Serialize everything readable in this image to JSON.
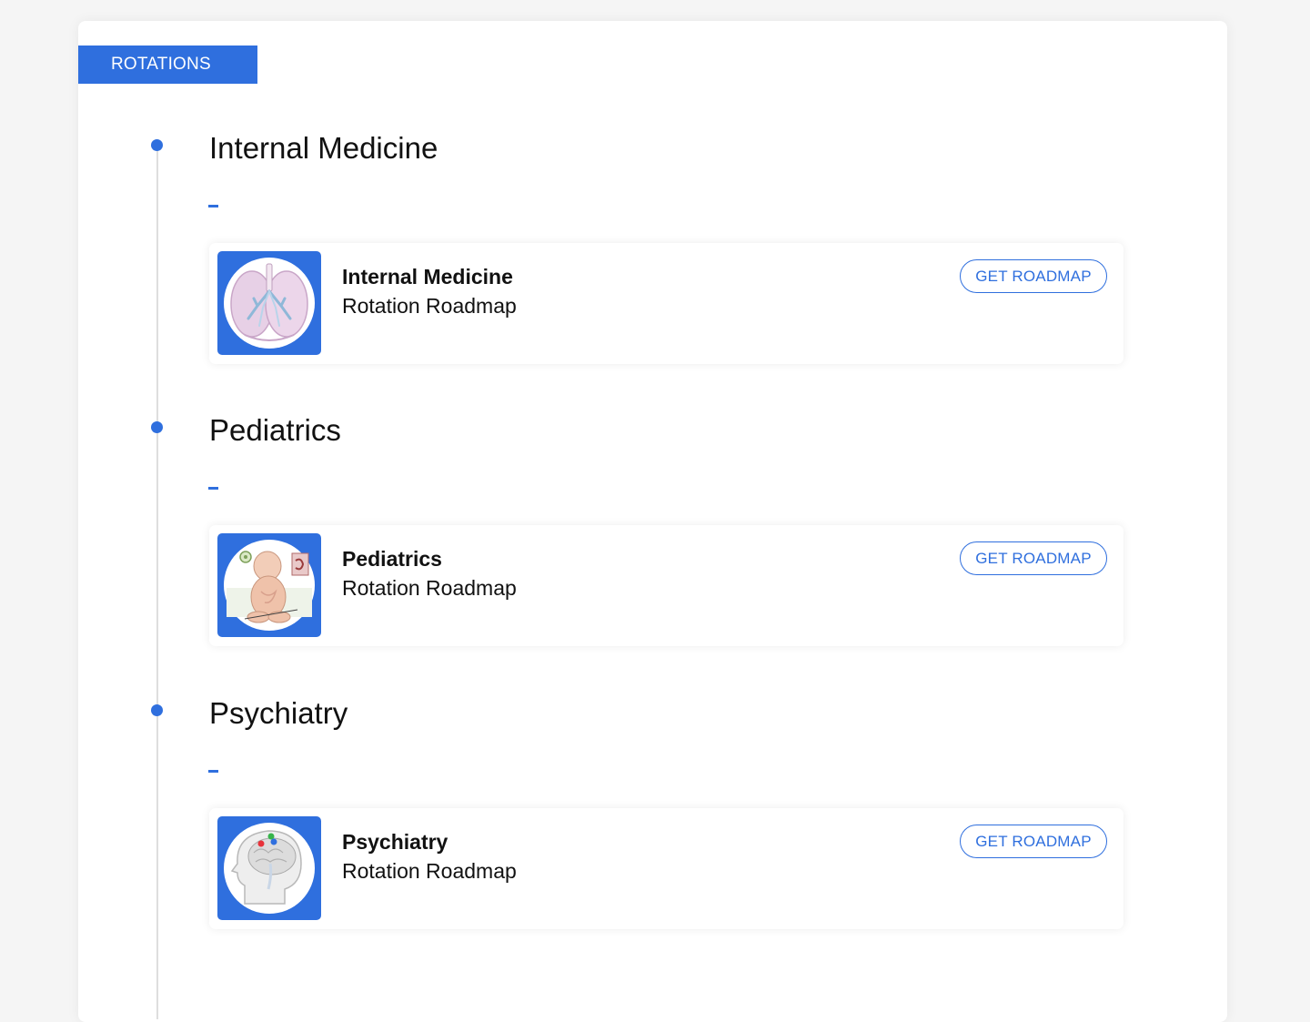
{
  "section": {
    "label": "ROTATIONS"
  },
  "rotations": [
    {
      "title": "Internal Medicine",
      "card_title": "Internal Medicine",
      "card_subtitle": "Rotation Roadmap",
      "button_label": "GET ROADMAP",
      "icon": "lungs-illustration-icon"
    },
    {
      "title": "Pediatrics",
      "card_title": "Pediatrics",
      "card_subtitle": "Rotation Roadmap",
      "button_label": "GET ROADMAP",
      "icon": "baby-illustration-icon"
    },
    {
      "title": "Psychiatry",
      "card_title": "Psychiatry",
      "card_subtitle": "Rotation Roadmap",
      "button_label": "GET ROADMAP",
      "icon": "brain-illustration-icon"
    }
  ],
  "colors": {
    "accent": "#2f6fde",
    "timeline": "#dedede",
    "page_background": "#f5f5f5"
  }
}
